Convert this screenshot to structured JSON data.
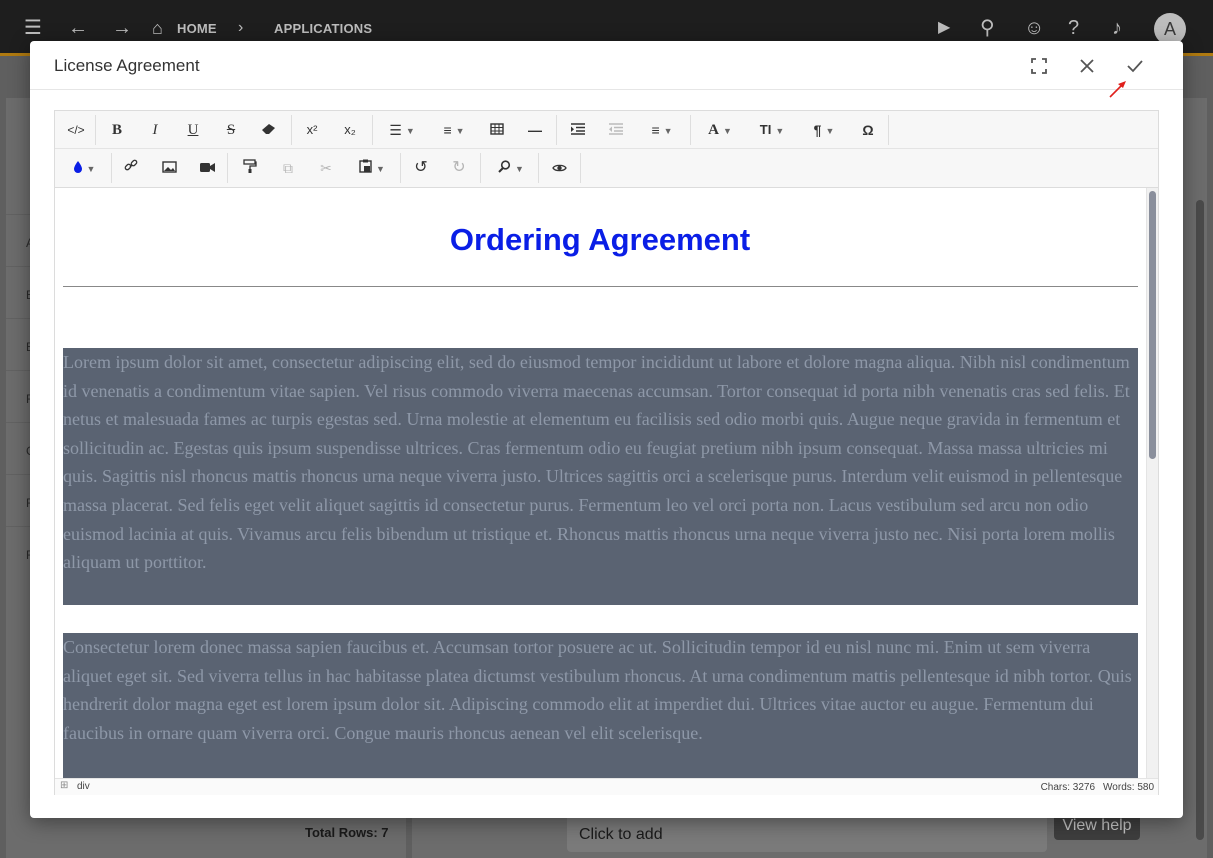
{
  "appbar": {
    "breadcrumb_home": "HOME",
    "breadcrumb_apps": "APPLICATIONS",
    "avatar_letter": "A"
  },
  "background": {
    "total_rows": "Total Rows: 7",
    "field_value": "Click to add",
    "help_label": "View help",
    "left_col_letters": [
      "A",
      "E",
      "E",
      "F",
      "C",
      "F",
      "F"
    ]
  },
  "dialog": {
    "title": "License Agreement"
  },
  "editor": {
    "doc_title": "Ordering Agreement",
    "paragraphs": [
      "Lorem ipsum dolor sit amet, consectetur adipiscing elit, sed do eiusmod tempor incididunt ut labore et dolore magna aliqua. Nibh nisl condimentum id venenatis a condimentum vitae sapien. Vel risus commodo viverra maecenas accumsan. Tortor consequat id porta nibh venenatis cras sed felis. Et netus et malesuada fames ac turpis egestas sed. Urna molestie at elementum eu facilisis sed odio morbi quis. Augue neque gravida in fermentum et sollicitudin ac. Egestas quis ipsum suspendisse ultrices. Cras fermentum odio eu feugiat pretium nibh ipsum consequat. Massa massa ultricies mi quis. Sagittis nisl rhoncus mattis rhoncus urna neque viverra justo. Ultrices sagittis orci a scelerisque purus. Interdum velit euismod in pellentesque massa placerat. Sed felis eget velit aliquet sagittis id consectetur purus. Fermentum leo vel orci porta non. Lacus vestibulum sed arcu non odio euismod lacinia at quis. Vivamus arcu felis bibendum ut tristique et. Rhoncus mattis rhoncus urna neque viverra justo nec. Nisi porta lorem mollis aliquam ut porttitor.",
      "Consectetur lorem donec massa sapien faucibus et. Accumsan tortor posuere ac ut. Sollicitudin tempor id eu nisl nunc mi. Enim ut sem viverra aliquet eget sit. Sed viverra tellus in hac habitasse platea dictumst vestibulum rhoncus. At urna condimentum mattis pellentesque id nibh tortor. Quis hendrerit dolor magna eget est lorem ipsum dolor sit. Adipiscing commodo elit at imperdiet dui. Ultrices vitae auctor eu augue. Fermentum dui faucibus in ornare quam viverra orci. Congue mauris rhoncus aenean vel elit scelerisque."
    ],
    "status_path": "div",
    "chars": "Chars: 3276",
    "words": "Words: 580"
  },
  "toolbar": {
    "superscript": "x²",
    "subscript": "x₂",
    "text_size": "TI",
    "omega": "Ω"
  },
  "colors": {
    "title_blue": "#0a1ee6",
    "selection_bg": "#5a6372",
    "accent_gold": "#b07a10"
  }
}
